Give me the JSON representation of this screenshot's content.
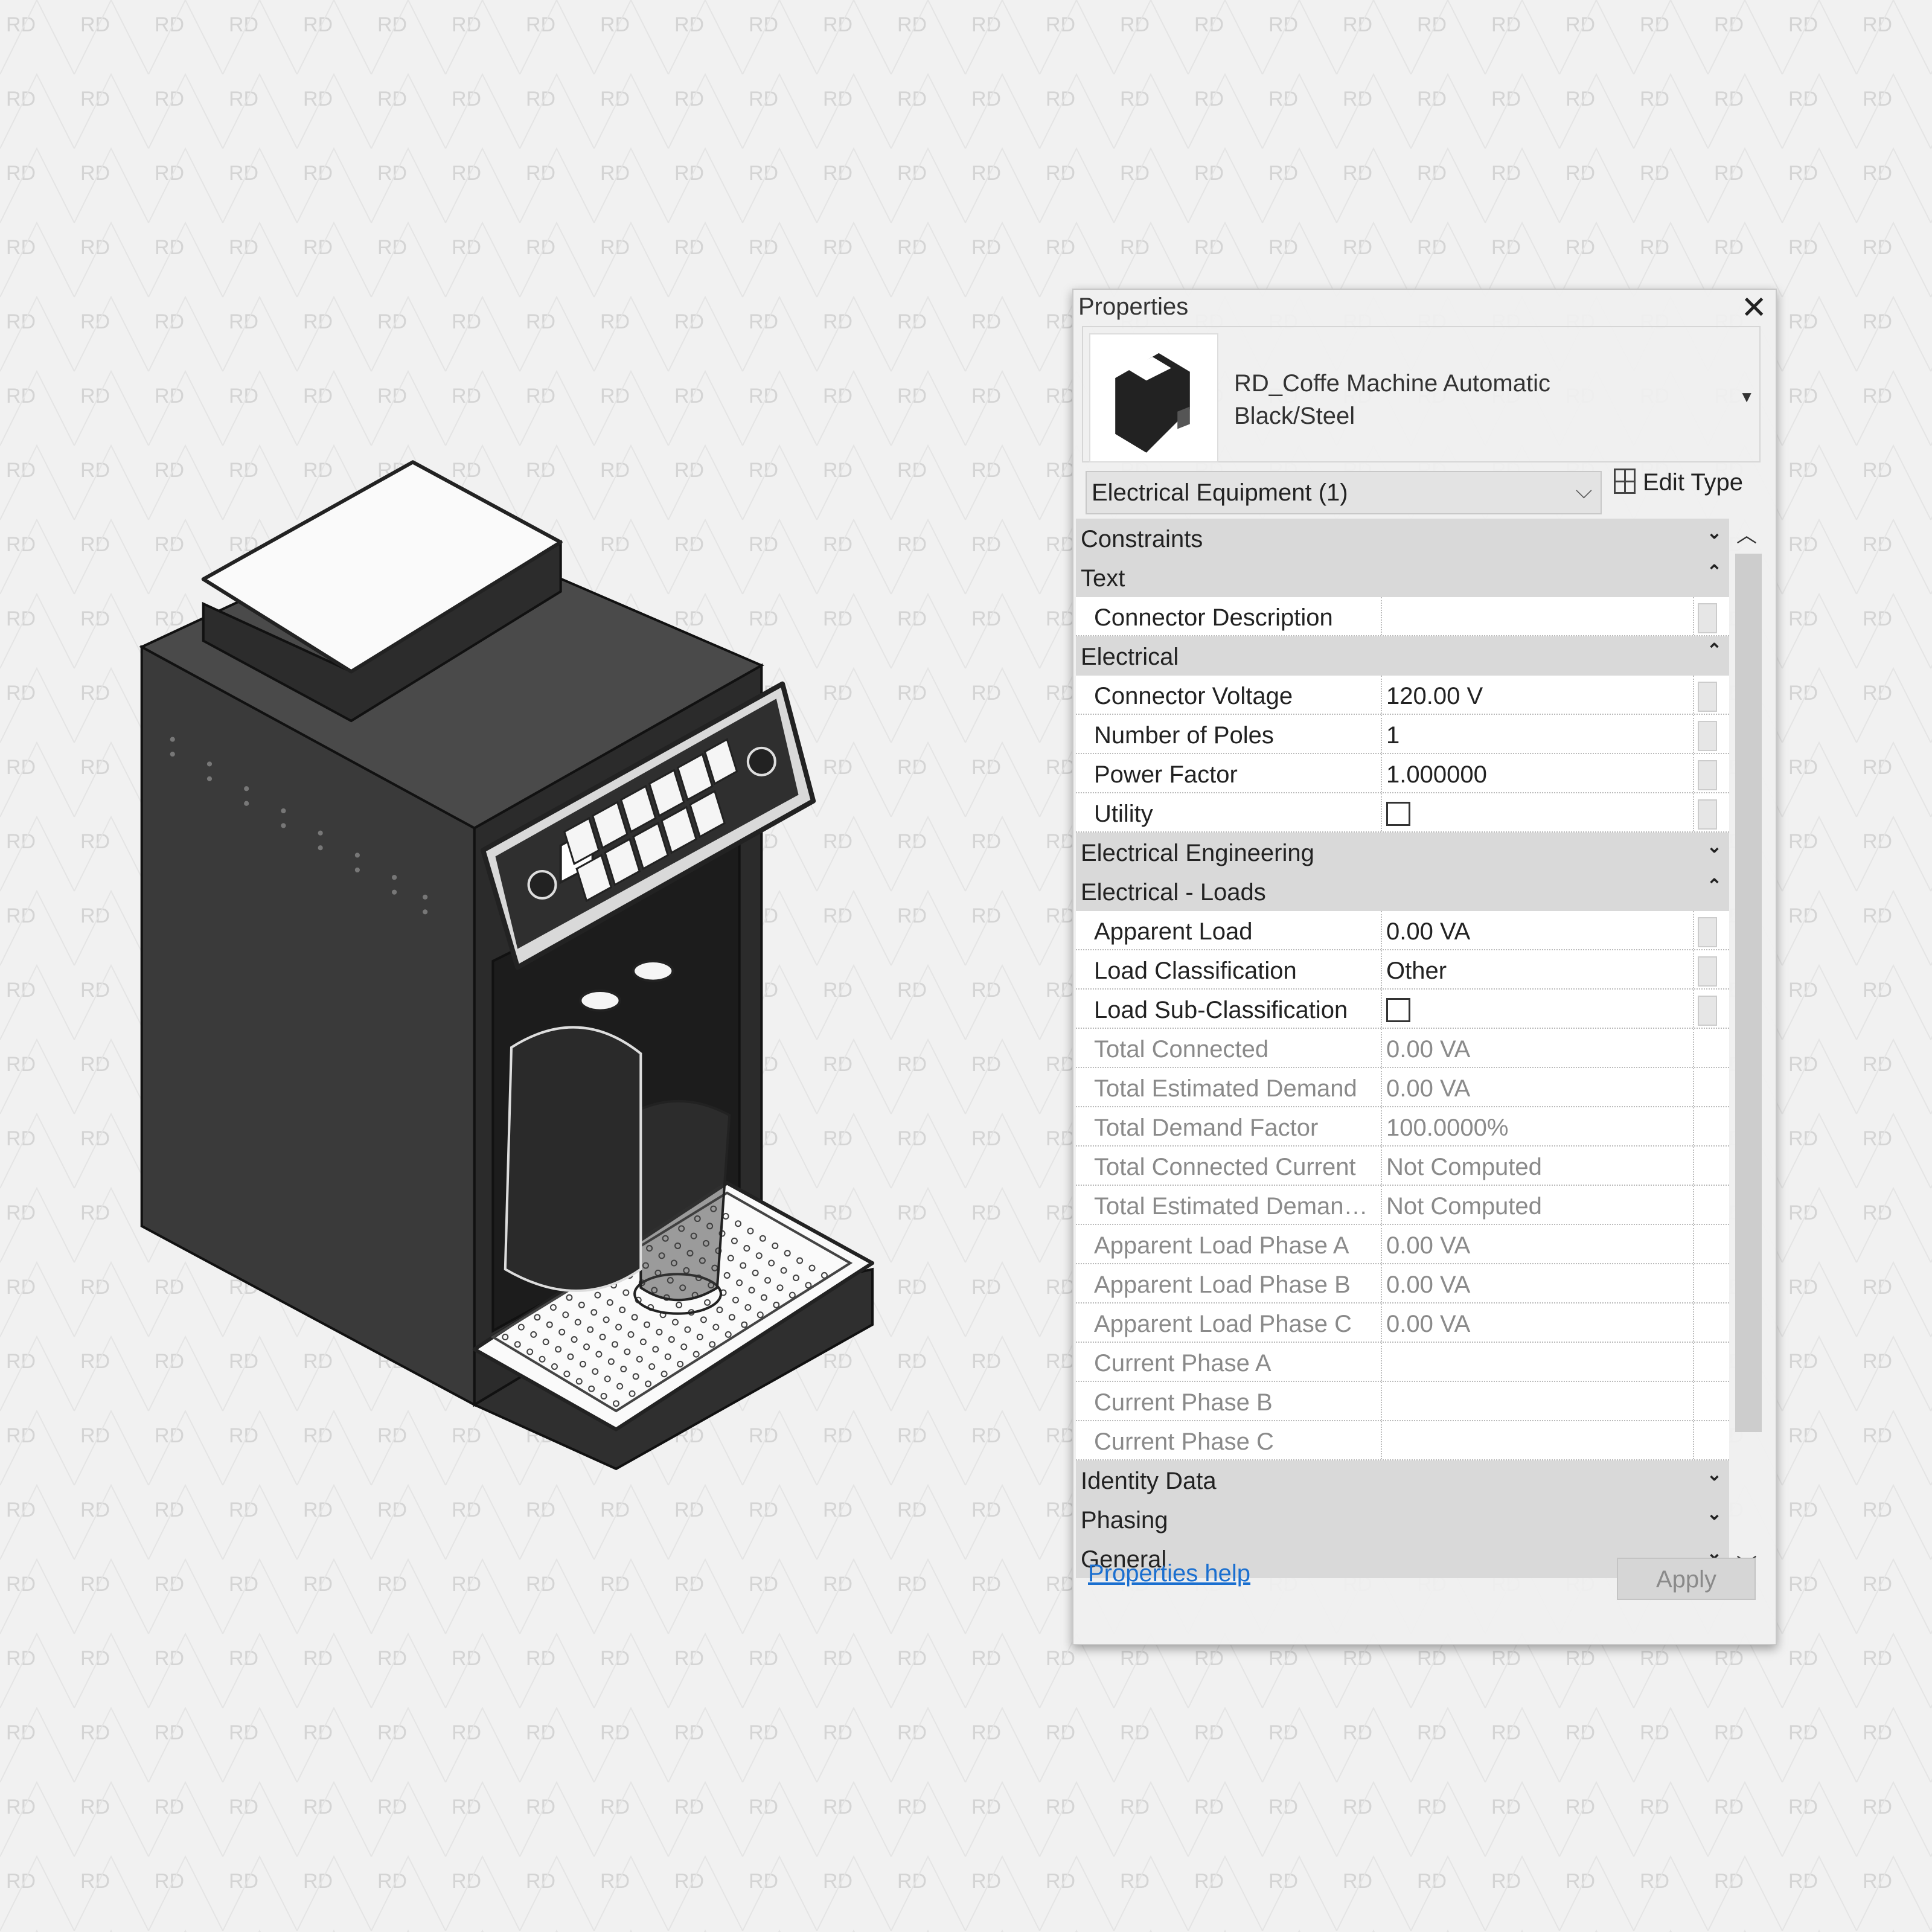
{
  "watermark": "RD",
  "properties": {
    "title": "Properties",
    "type_name_line1": "RD_Coffe Machine Automatic",
    "type_name_line2": "Black/Steel",
    "category": "Electrical Equipment (1)",
    "edit_type": "Edit Type",
    "help_link": "Properties help",
    "apply": "Apply",
    "rows": [
      {
        "kind": "group",
        "label": "Constraints",
        "toggle": "collapsed"
      },
      {
        "kind": "group",
        "label": "Text",
        "toggle": "expanded"
      },
      {
        "kind": "prop",
        "label": "Connector Description",
        "value": "",
        "ro": false
      },
      {
        "kind": "group",
        "label": "Electrical",
        "toggle": "expanded"
      },
      {
        "kind": "prop",
        "label": "Connector Voltage",
        "value": "120.00 V",
        "ro": false
      },
      {
        "kind": "prop",
        "label": "Number of Poles",
        "value": "1",
        "ro": false
      },
      {
        "kind": "prop",
        "label": "Power Factor",
        "value": "1.000000",
        "ro": false
      },
      {
        "kind": "prop",
        "label": "Utility",
        "checkbox": false,
        "ro": false
      },
      {
        "kind": "group",
        "label": "Electrical Engineering",
        "toggle": "collapsed"
      },
      {
        "kind": "group",
        "label": "Electrical - Loads",
        "toggle": "expanded"
      },
      {
        "kind": "prop",
        "label": "Apparent Load",
        "value": "0.00 VA",
        "ro": false
      },
      {
        "kind": "prop",
        "label": "Load Classification",
        "value": "Other",
        "ro": false
      },
      {
        "kind": "prop",
        "label": "Load Sub-Classification",
        "checkbox": false,
        "ro": false
      },
      {
        "kind": "prop",
        "label": "Total Connected",
        "value": "0.00 VA",
        "ro": true
      },
      {
        "kind": "prop",
        "label": "Total Estimated Demand",
        "value": "0.00 VA",
        "ro": true
      },
      {
        "kind": "prop",
        "label": "Total Demand Factor",
        "value": "100.0000%",
        "ro": true
      },
      {
        "kind": "prop",
        "label": "Total Connected Current",
        "value": "Not Computed",
        "ro": true
      },
      {
        "kind": "prop",
        "label": "Total Estimated Demand ...",
        "value": "Not Computed",
        "ro": true
      },
      {
        "kind": "prop",
        "label": "Apparent Load Phase A",
        "value": "0.00 VA",
        "ro": true
      },
      {
        "kind": "prop",
        "label": "Apparent Load Phase B",
        "value": "0.00 VA",
        "ro": true
      },
      {
        "kind": "prop",
        "label": "Apparent Load Phase C",
        "value": "0.00 VA",
        "ro": true
      },
      {
        "kind": "prop",
        "label": "Current Phase A",
        "value": "",
        "ro": true
      },
      {
        "kind": "prop",
        "label": "Current Phase B",
        "value": "",
        "ro": true
      },
      {
        "kind": "prop",
        "label": "Current Phase C",
        "value": "",
        "ro": true
      },
      {
        "kind": "group",
        "label": "Identity Data",
        "toggle": "collapsed"
      },
      {
        "kind": "group",
        "label": "Phasing",
        "toggle": "collapsed"
      },
      {
        "kind": "group",
        "label": "General",
        "toggle": "collapsed"
      }
    ]
  }
}
